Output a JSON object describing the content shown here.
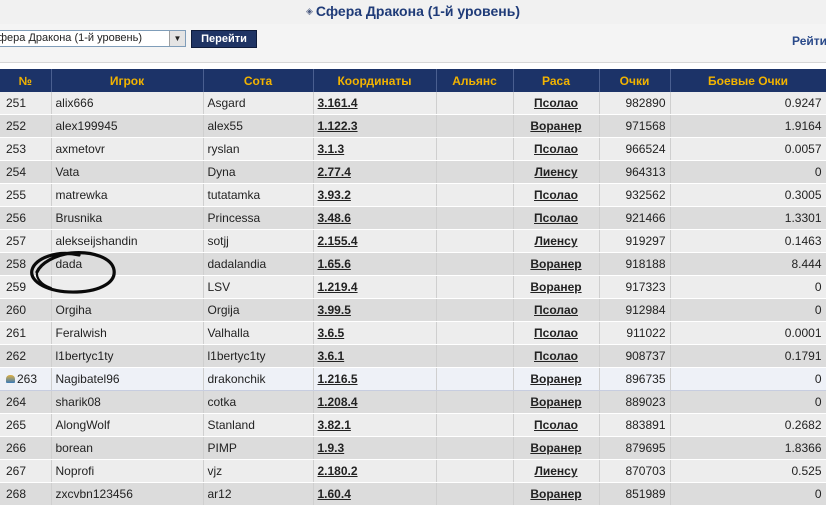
{
  "header": {
    "title": "Сфера Дракона (1-й уровень)"
  },
  "controls": {
    "select_value": "фера Дракона (1-й уровень)",
    "go_label": "Перейти",
    "rating_link": "Рейти"
  },
  "table": {
    "columns": [
      "№",
      "Игрок",
      "Сота",
      "Координаты",
      "Альянс",
      "Раса",
      "Очки",
      "Боевые Очки"
    ],
    "rows": [
      {
        "rank": "251",
        "player": "alix666",
        "hive": "Asgard",
        "coords": "3.161.4",
        "alliance": "",
        "race": "Псолао",
        "points": "982890",
        "battle": "0.9247"
      },
      {
        "rank": "252",
        "player": "alex199945",
        "hive": "alex55",
        "coords": "1.122.3",
        "alliance": "",
        "race": "Воранер",
        "points": "971568",
        "battle": "1.9164"
      },
      {
        "rank": "253",
        "player": "axmetovr",
        "hive": "ryslan",
        "coords": "3.1.3",
        "alliance": "",
        "race": "Псолао",
        "points": "966524",
        "battle": "0.0057"
      },
      {
        "rank": "254",
        "player": "Vata",
        "hive": "Dyna",
        "coords": "2.77.4",
        "alliance": "",
        "race": "Лиенсу",
        "points": "964313",
        "battle": "0"
      },
      {
        "rank": "255",
        "player": "matrewka",
        "hive": "tutatamka",
        "coords": "3.93.2",
        "alliance": "",
        "race": "Псолао",
        "points": "932562",
        "battle": "0.3005"
      },
      {
        "rank": "256",
        "player": "Brusnika",
        "hive": "Princessa",
        "coords": "3.48.6",
        "alliance": "",
        "race": "Псолао",
        "points": "921466",
        "battle": "1.3301"
      },
      {
        "rank": "257",
        "player": "alekseijshandin",
        "hive": "sotjj",
        "coords": "2.155.4",
        "alliance": "",
        "race": "Лиенсу",
        "points": "919297",
        "battle": "0.1463"
      },
      {
        "rank": "258",
        "player": "dada",
        "hive": "dadalandia",
        "coords": "1.65.6",
        "alliance": "",
        "race": "Воранер",
        "points": "918188",
        "battle": "8.444"
      },
      {
        "rank": "259",
        "player": "",
        "hive": "LSV",
        "coords": "1.219.4",
        "alliance": "",
        "race": "Воранер",
        "points": "917323",
        "battle": "0"
      },
      {
        "rank": "260",
        "player": "Orgiha",
        "hive": "Orgija",
        "coords": "3.99.5",
        "alliance": "",
        "race": "Псолао",
        "points": "912984",
        "battle": "0"
      },
      {
        "rank": "261",
        "player": "Feralwish",
        "hive": "Valhalla",
        "coords": "3.6.5",
        "alliance": "",
        "race": "Псолао",
        "points": "911022",
        "battle": "0.0001"
      },
      {
        "rank": "262",
        "player": "l1bertyc1ty",
        "hive": "l1bertyc1ty",
        "coords": "3.6.1",
        "alliance": "",
        "race": "Псолао",
        "points": "908737",
        "battle": "0.1791"
      },
      {
        "rank": "263",
        "player": "Nagibatel96",
        "hive": "drakonchik",
        "coords": "1.216.5",
        "alliance": "",
        "race": "Воранер",
        "points": "896735",
        "battle": "0",
        "me": true
      },
      {
        "rank": "264",
        "player": "sharik08",
        "hive": "cotka",
        "coords": "1.208.4",
        "alliance": "",
        "race": "Воранер",
        "points": "889023",
        "battle": "0"
      },
      {
        "rank": "265",
        "player": "AlongWolf",
        "hive": "Stanland",
        "coords": "3.82.1",
        "alliance": "",
        "race": "Псолао",
        "points": "883891",
        "battle": "0.2682"
      },
      {
        "rank": "266",
        "player": "borean",
        "hive": "PIMP",
        "coords": "1.9.3",
        "alliance": "",
        "race": "Воранер",
        "points": "879695",
        "battle": "1.8366"
      },
      {
        "rank": "267",
        "player": "Noprofi",
        "hive": "vjz",
        "coords": "2.180.2",
        "alliance": "",
        "race": "Лиенсу",
        "points": "870703",
        "battle": "0.525"
      },
      {
        "rank": "268",
        "player": "zxcvbn123456",
        "hive": "ar12",
        "coords": "1.60.4",
        "alliance": "",
        "race": "Воранер",
        "points": "851989",
        "battle": "0"
      }
    ]
  },
  "colors": {
    "header_bg": "#1c3368",
    "header_text": "#f2b300",
    "title_text": "#1f3b78",
    "button_bg": "#1f3464"
  },
  "icons": {
    "title_bullet": "bullet-icon",
    "current_player": "player-marker-icon",
    "annotation": "ink-circle-annotation"
  }
}
